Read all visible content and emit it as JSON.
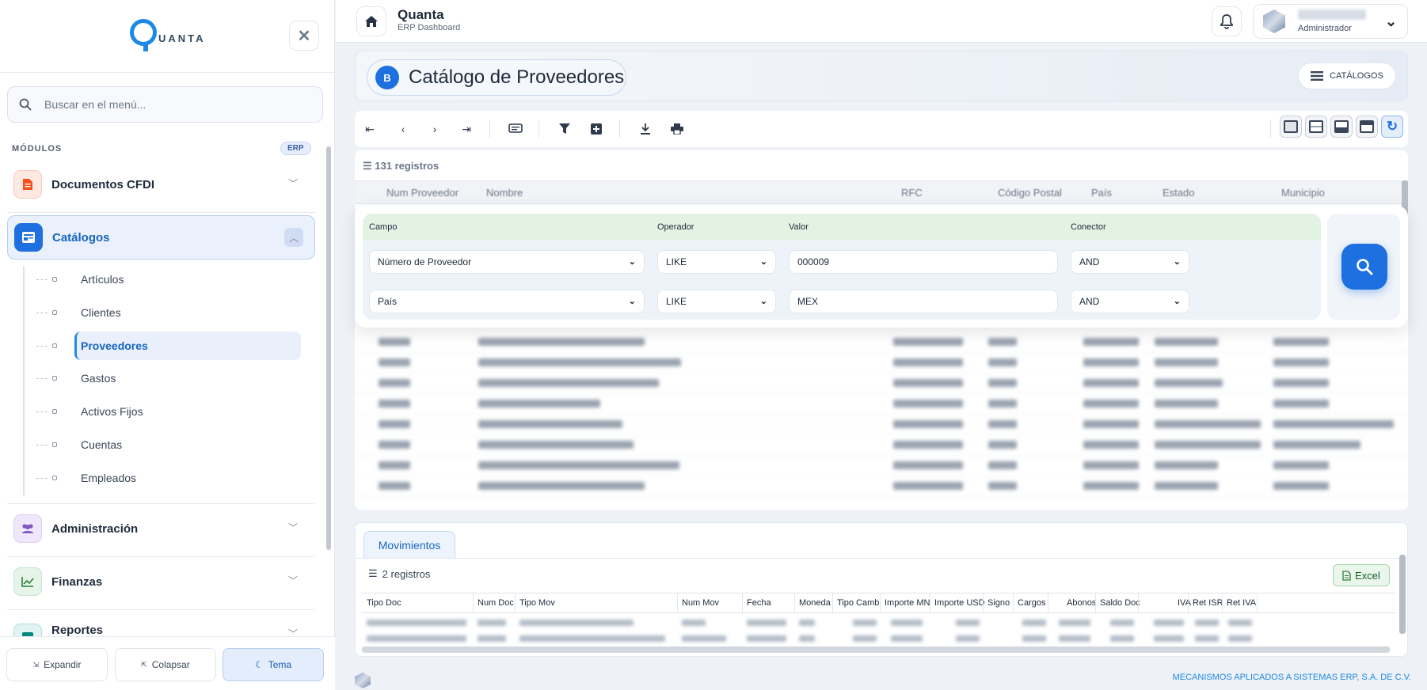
{
  "sidebar": {
    "logo_text": "UANTA",
    "search_placeholder": "Buscar en el menú...",
    "modules_label": "MÓDULOS",
    "modules_badge": "ERP",
    "modules": [
      {
        "label": "Documentos CFDI",
        "icon": "document-icon",
        "color": "#f4511e"
      },
      {
        "label": "Catálogos",
        "icon": "catalog-icon",
        "color": "#1e6fe0"
      },
      {
        "label": "Administración",
        "icon": "users-icon",
        "color": "#7e57c2"
      },
      {
        "label": "Finanzas",
        "icon": "chart-icon",
        "color": "#2e7d32"
      },
      {
        "label": "Reportes",
        "icon": "report-icon",
        "color": "#00897b"
      }
    ],
    "subitems": [
      "Artículos",
      "Clientes",
      "Proveedores",
      "Gastos",
      "Activos Fijos",
      "Cuentas",
      "Empleados"
    ],
    "bottom": {
      "expand": "Expandir",
      "collapse": "Colapsar",
      "theme": "Tema"
    }
  },
  "topbar": {
    "title": "Quanta",
    "subtitle": "ERP Dashboard",
    "user_role": "Administrador"
  },
  "page": {
    "title": "Catálogo de Proveedores",
    "catalogs_button": "CATÁLOGOS"
  },
  "grid": {
    "record_count": "131 registros",
    "columns": [
      "Num Proveedor",
      "Nombre",
      "RFC",
      "Código Postal",
      "País",
      "Estado",
      "Municipio"
    ]
  },
  "filter": {
    "headers": {
      "field": "Campo",
      "operator": "Operador",
      "value": "Valor",
      "connector": "Conector"
    },
    "rows": [
      {
        "field": "Número de Proveedor",
        "operator": "LIKE",
        "value": "000009",
        "connector": "AND"
      },
      {
        "field": "País",
        "operator": "LIKE",
        "value": "MEX",
        "connector": "AND"
      }
    ]
  },
  "movements": {
    "tab_label": "Movimientos",
    "record_count": "2 registros",
    "excel_label": "Excel",
    "columns": [
      "Tipo Doc",
      "Num Doc",
      "Tipo Mov",
      "Num Mov",
      "Fecha",
      "Moneda",
      "Tipo Camb",
      "Importe MN",
      "Importe USD",
      "Signo",
      "Cargos",
      "Abonos",
      "Saldo Doc",
      "IVA",
      "Ret ISR",
      "Ret IVA"
    ]
  },
  "footer": {
    "company": "MECANISMOS APLICADOS A SISTEMAS ERP, S.A. DE C.V."
  },
  "colors": {
    "accent": "#1e6fe0",
    "active_bg": "#eaf1fc",
    "filter_header": "#e2f3e4"
  }
}
